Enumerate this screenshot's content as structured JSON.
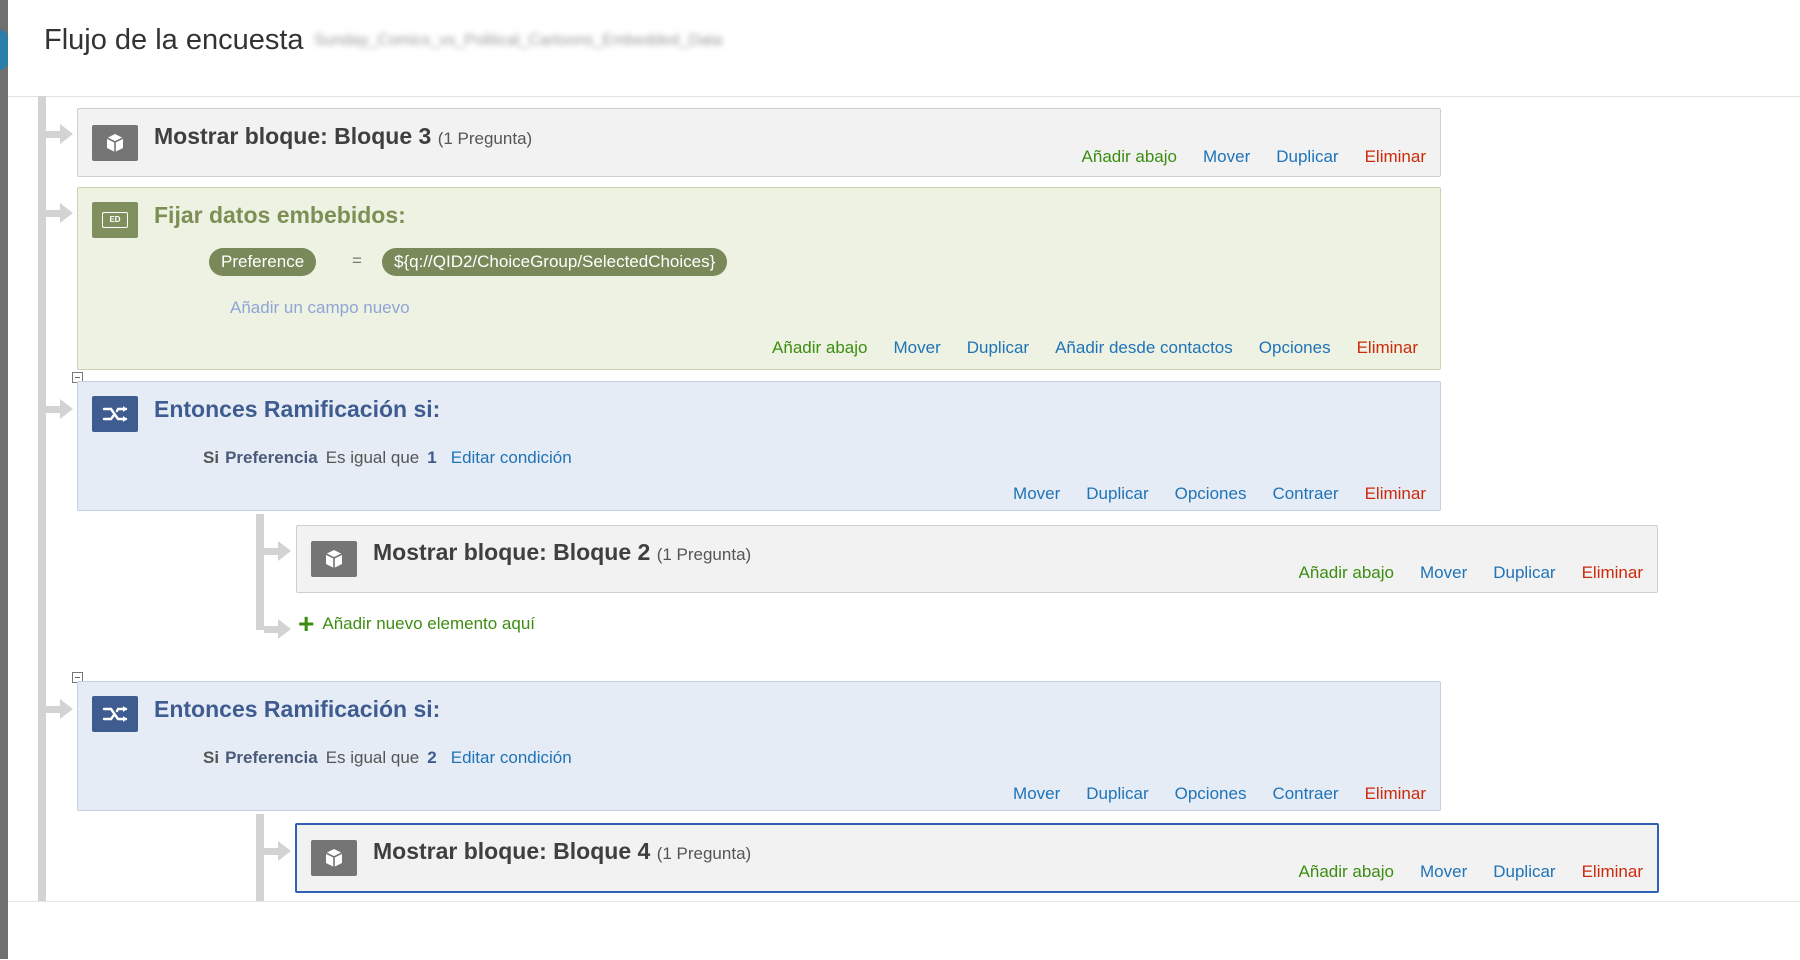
{
  "header": {
    "title": "Flujo de la encuesta",
    "subtitle": "Sunday_Comics_vs_Political_Cartoons_Embedded_Data"
  },
  "icons": {
    "block": "cube-icon",
    "embedded": "embedded-data-icon",
    "embedded_text": "ED",
    "branch": "branch-icon",
    "collapse": "collapse-toggle-icon",
    "add": "plus-icon"
  },
  "colors": {
    "add_action": "#3c8d12",
    "link_action": "#1f73b7",
    "delete_action": "#cc2a0a",
    "embedded_bg": "#eef2e2",
    "branch_bg": "#e6ecf5",
    "block_bg": "#f2f2f2"
  },
  "flow": {
    "block3": {
      "title": "Mostrar bloque: Bloque 3",
      "count": "(1 Pregunta)",
      "actions": {
        "add_below": "Añadir abajo",
        "move": "Mover",
        "duplicate": "Duplicar",
        "delete": "Eliminar"
      }
    },
    "embedded": {
      "title": "Fijar datos embebidos:",
      "field_name": "Preference",
      "equals": "=",
      "field_value": "${q://QID2/ChoiceGroup/SelectedChoices}",
      "add_field": "Añadir un campo nuevo",
      "actions": {
        "add_below": "Añadir abajo",
        "move": "Mover",
        "duplicate": "Duplicar",
        "add_from_contacts": "Añadir desde contactos",
        "options": "Opciones",
        "delete": "Eliminar"
      }
    },
    "branch1": {
      "title": "Entonces Ramificación si:",
      "condition": {
        "if": "Si",
        "field": "Preferencia",
        "operator": "Es igual que",
        "value": "1",
        "edit": "Editar condición"
      },
      "actions": {
        "move": "Mover",
        "duplicate": "Duplicar",
        "options": "Opciones",
        "collapse": "Contraer",
        "delete": "Eliminar"
      }
    },
    "block2": {
      "title": "Mostrar bloque: Bloque 2",
      "count": "(1 Pregunta)",
      "actions": {
        "add_below": "Añadir abajo",
        "move": "Mover",
        "duplicate": "Duplicar",
        "delete": "Eliminar"
      }
    },
    "add_new": "Añadir nuevo elemento aquí",
    "branch2": {
      "title": "Entonces Ramificación si:",
      "condition": {
        "if": "Si",
        "field": "Preferencia",
        "operator": "Es igual que",
        "value": "2",
        "edit": "Editar condición"
      },
      "actions": {
        "move": "Mover",
        "duplicate": "Duplicar",
        "options": "Opciones",
        "collapse": "Contraer",
        "delete": "Eliminar"
      }
    },
    "block4": {
      "title": "Mostrar bloque: Bloque 4",
      "count": "(1 Pregunta)",
      "actions": {
        "add_below": "Añadir abajo",
        "move": "Mover",
        "duplicate": "Duplicar",
        "delete": "Eliminar"
      }
    }
  }
}
